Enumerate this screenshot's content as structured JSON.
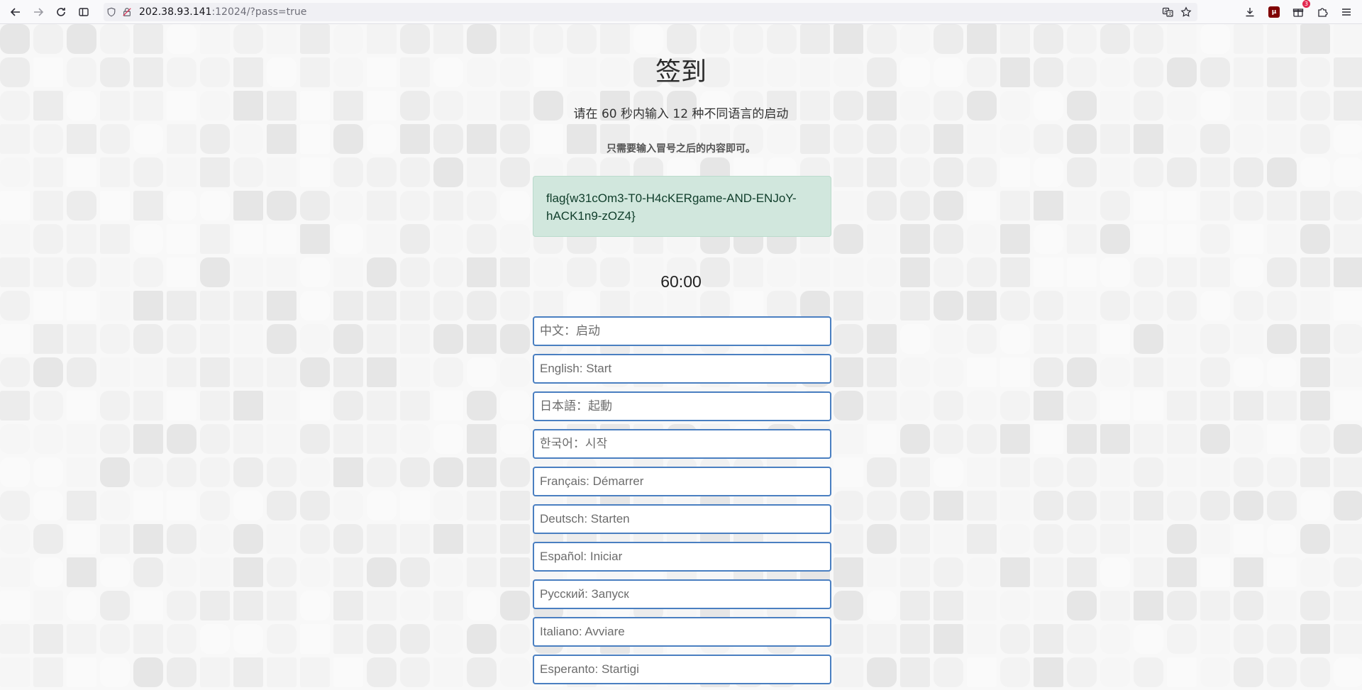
{
  "browser": {
    "url_host": "202.38.93.141",
    "url_rest": ":12024/?pass=true",
    "extension_badge": "3"
  },
  "page": {
    "title": "签到",
    "subtitle": "请在 60 秒内输入 12 种不同语言的启动",
    "note": "只需要输入冒号之后的内容即可。",
    "flag": "flag{w31cOm3-T0-H4cKERgame-AND-ENJoY-hACK1n9-zOZ4}",
    "timer": "60:00",
    "inputs": [
      {
        "placeholder": "中文：启动"
      },
      {
        "placeholder": "English: Start"
      },
      {
        "placeholder": "日本語：起動"
      },
      {
        "placeholder": "한국어：시작"
      },
      {
        "placeholder": "Français: Démarrer"
      },
      {
        "placeholder": "Deutsch: Starten"
      },
      {
        "placeholder": "Español: Iniciar"
      },
      {
        "placeholder": "Русский: Запуск"
      },
      {
        "placeholder": "Italiano: Avviare"
      },
      {
        "placeholder": "Esperanto: Startigi"
      }
    ]
  },
  "colors": {
    "flag_bg": "#d1e7dd",
    "input_border": "#4a7fc1"
  }
}
